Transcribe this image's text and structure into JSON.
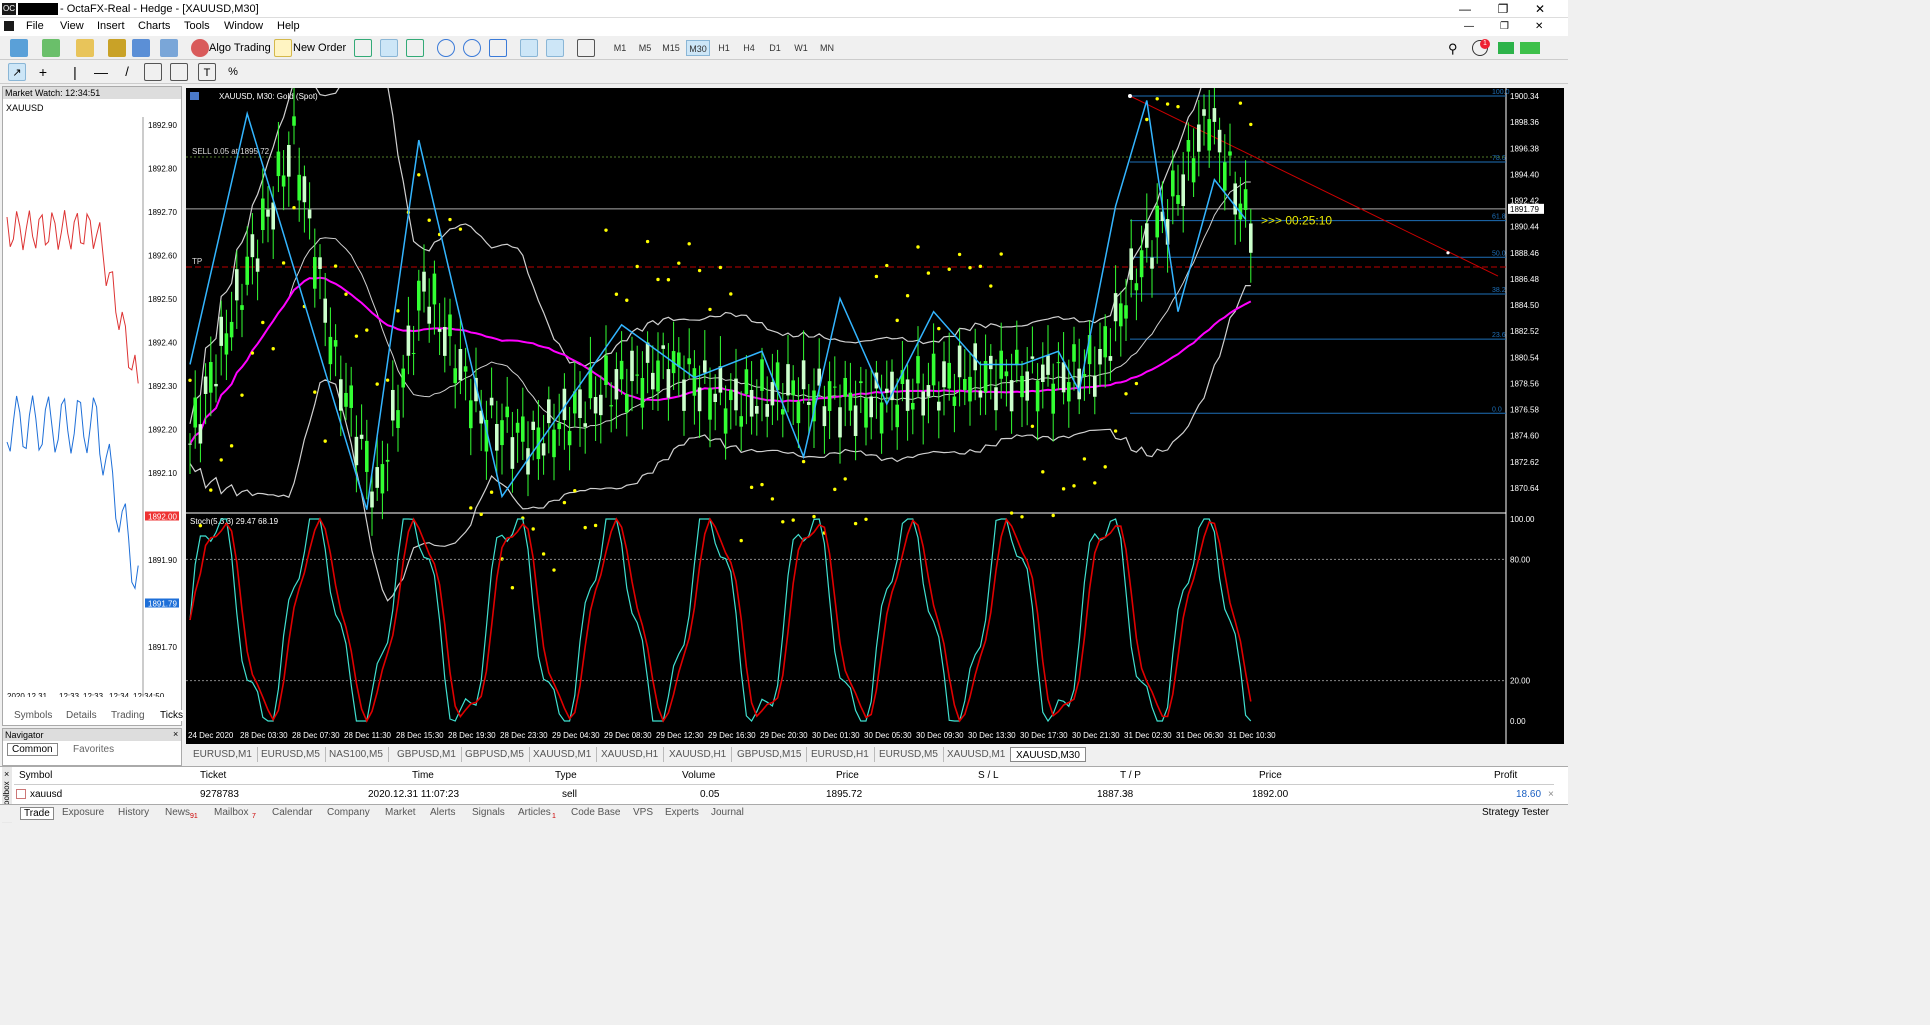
{
  "window": {
    "title": "- OctaFX-Real - Hedge - [XAUUSD,M30]"
  },
  "menu": [
    "File",
    "View",
    "Insert",
    "Charts",
    "Tools",
    "Window",
    "Help"
  ],
  "toolbar": {
    "algo_trading": "Algo Trading",
    "new_order": "New Order",
    "timeframes": [
      "M1",
      "M5",
      "M15",
      "M30",
      "H1",
      "H4",
      "D1",
      "W1",
      "MN"
    ],
    "active_timeframe": "M30"
  },
  "market_watch": {
    "title": "Market Watch: 12:34:51",
    "symbol": "XAUUSD",
    "price_levels": [
      "1892.90",
      "1892.80",
      "1892.70",
      "1892.60",
      "1892.50",
      "1892.40",
      "1892.30",
      "1892.20",
      "1892.10",
      "1892.00",
      "1891.90",
      "1891.79",
      "1891.70"
    ],
    "time_labels": [
      "2020.12.31",
      "12:33",
      "12:33",
      "12:34",
      "12:34:50"
    ],
    "tabs": [
      "Symbols",
      "Details",
      "Trading",
      "Ticks"
    ],
    "active_tab": "Ticks"
  },
  "navigator": {
    "title": "Navigator",
    "tabs": [
      "Common",
      "Favorites"
    ],
    "active_tab": "Common"
  },
  "chart": {
    "header": "XAUUSD, M30: Gold (Spot)",
    "sell_label": "SELL 0.05 at 1895.72",
    "tp_label": "TP",
    "countdown": ">>> 00:25:10",
    "price_axis": [
      "1900.34",
      "1898.36",
      "1896.38",
      "1894.40",
      "1892.42",
      "1890.44",
      "1888.46",
      "1886.48",
      "1884.50",
      "1882.52",
      "1880.54",
      "1878.56",
      "1876.58",
      "1874.60",
      "1872.62",
      "1870.64"
    ],
    "current_price": "1891.79",
    "fib_levels": [
      "100.0",
      "78.6",
      "61.8",
      "50.0",
      "38.2",
      "23.6",
      "0.0"
    ],
    "stoch_label": "Stoch(5,3,3) 29.47 68.19",
    "stoch_axis": [
      "100.00",
      "80.00",
      "20.00",
      "0.00"
    ],
    "time_axis": [
      "24 Dec 2020",
      "28 Dec 03:30",
      "28 Dec 07:30",
      "28 Dec 11:30",
      "28 Dec 15:30",
      "28 Dec 19:30",
      "28 Dec 23:30",
      "29 Dec 04:30",
      "29 Dec 08:30",
      "29 Dec 12:30",
      "29 Dec 16:30",
      "29 Dec 20:30",
      "30 Dec 01:30",
      "30 Dec 05:30",
      "30 Dec 09:30",
      "30 Dec 13:30",
      "30 Dec 17:30",
      "30 Dec 21:30",
      "31 Dec 02:30",
      "31 Dec 06:30",
      "31 Dec 10:30"
    ],
    "colors": {
      "bull": "#ccffcc",
      "bear": "#33ff33",
      "ma": "#ff00ff",
      "bands": "#d0d0d0",
      "sar": "#ffff00",
      "zigzag": "#33b5ff",
      "fib": "#1e6fb8",
      "trend": "#cc0000",
      "stoch_main": "#40e0d0",
      "stoch_signal": "#e00000"
    }
  },
  "chart_tabs": [
    "EURUSD,M1",
    "EURUSD,M5",
    "NAS100,M5",
    "GBPUSD,M1",
    "GBPUSD,M5",
    "XAUUSD,M1",
    "XAUUSD,H1",
    "XAUUSD,H1",
    "GBPUSD,M15",
    "EURUSD,H1",
    "EURUSD,M5",
    "XAUUSD,M1",
    "XAUUSD,M30"
  ],
  "active_chart_tab": "XAUUSD,M30",
  "toolbox": {
    "columns": [
      "Symbol",
      "Ticket",
      "Time",
      "Type",
      "Volume",
      "Price",
      "S / L",
      "T / P",
      "Price",
      "Profit"
    ],
    "row": {
      "symbol": "xauusd",
      "ticket": "9278783",
      "time": "2020.12.31 11:07:23",
      "type": "sell",
      "volume": "0.05",
      "price": "1895.72",
      "sl": "",
      "tp": "1887.38",
      "current": "1892.00",
      "profit": "18.60"
    },
    "side_label": "Toolbox"
  },
  "bottom_tabs": [
    "Trade",
    "Exposure",
    "History",
    "News",
    "Mailbox",
    "Calendar",
    "Company",
    "Market",
    "Alerts",
    "Signals",
    "Articles",
    "Code Base",
    "VPS",
    "Experts",
    "Journal"
  ],
  "bottom_badges": {
    "news": "91",
    "mailbox": "7",
    "articles": "1"
  },
  "strategy_tester": "Strategy Tester"
}
